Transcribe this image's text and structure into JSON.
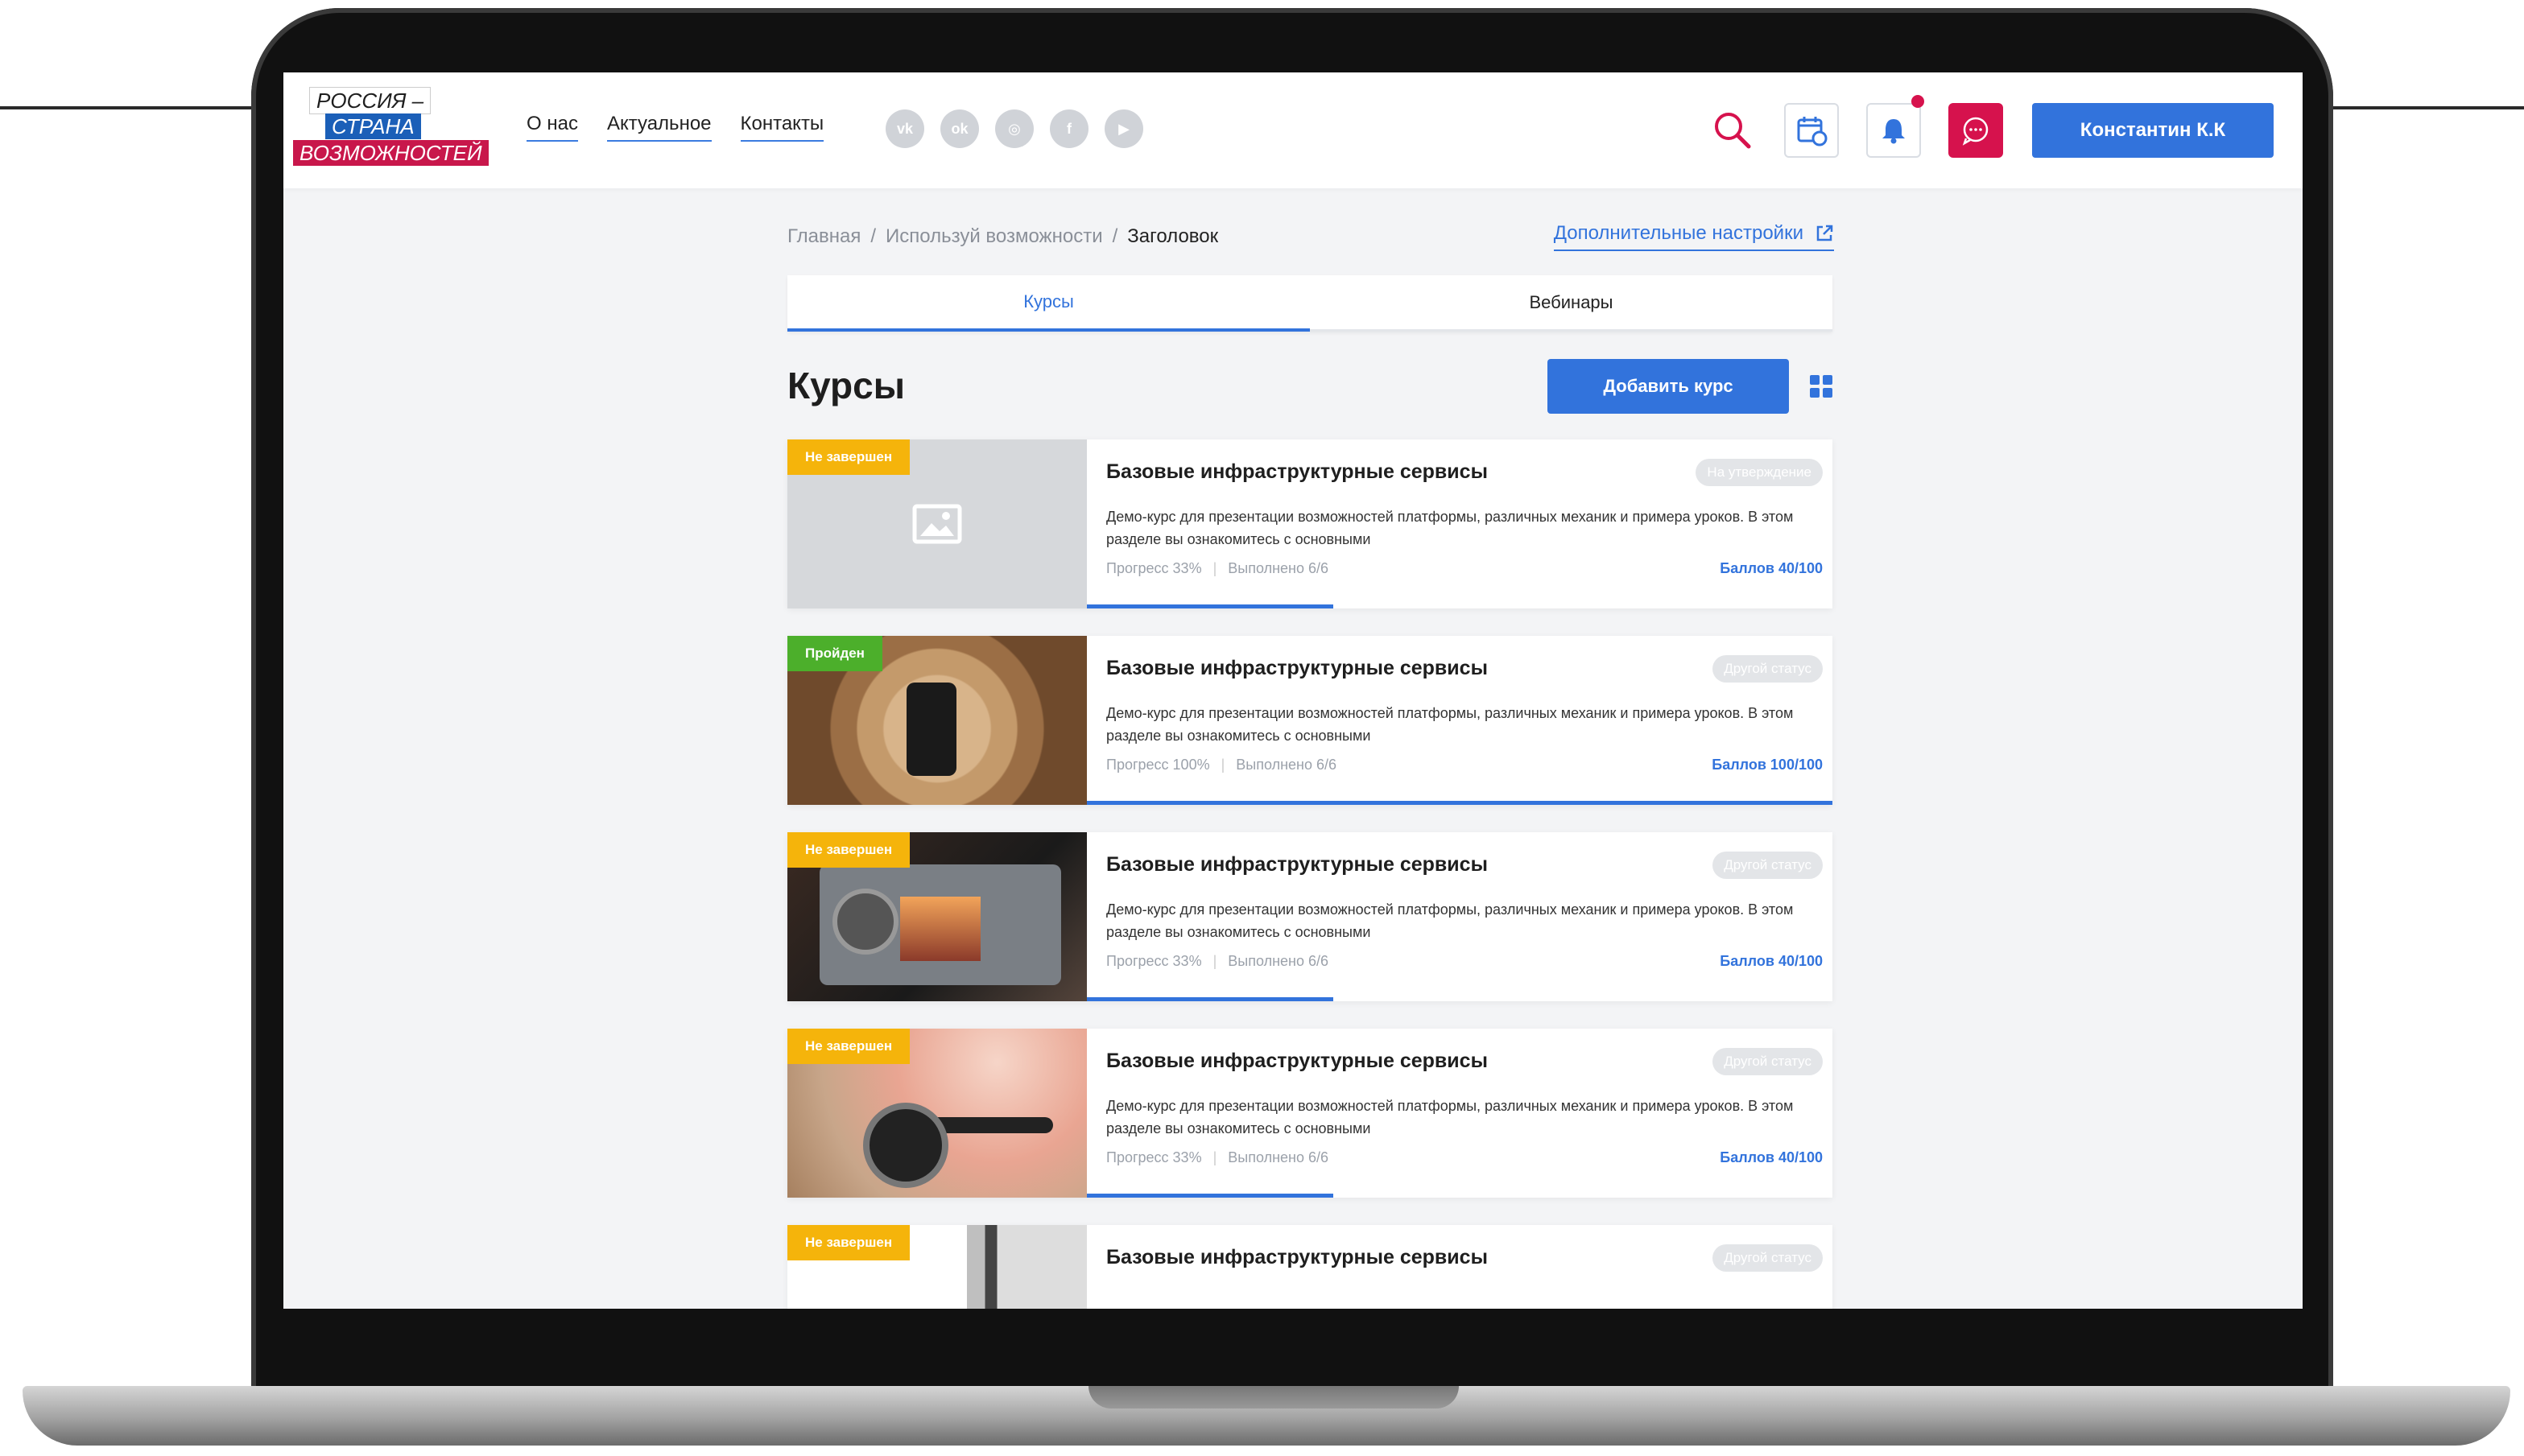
{
  "logo": {
    "line1": "РОССИЯ –",
    "line2": "СТРАНА",
    "line3": "ВОЗМОЖНОСТЕЙ"
  },
  "nav": [
    {
      "label": "О нас"
    },
    {
      "label": "Актуальное"
    },
    {
      "label": "Контакты"
    }
  ],
  "socials": [
    {
      "icon": "vk-icon",
      "glyph": "vk"
    },
    {
      "icon": "odnoklassniki-icon",
      "glyph": "ok"
    },
    {
      "icon": "instagram-icon",
      "glyph": "◎"
    },
    {
      "icon": "facebook-icon",
      "glyph": "f"
    },
    {
      "icon": "youtube-icon",
      "glyph": "▶"
    }
  ],
  "user": {
    "name": "Константин К.К"
  },
  "colors": {
    "accent": "#3273dc",
    "brand_red": "#d6124d",
    "badge_incomplete": "#f5b40b",
    "badge_passed": "#4caf2b"
  },
  "breadcrumbs": {
    "home": "Главная",
    "section": "Используй возможности",
    "current": "Заголовок"
  },
  "extra_settings": "Дополнительные настройки",
  "tabs": [
    {
      "label": "Курсы",
      "active": true
    },
    {
      "label": "Вебинары",
      "active": false
    }
  ],
  "page_title": "Курсы",
  "add_button": "Добавить курс",
  "courses": [
    {
      "badge": "Не завершен",
      "title": "Базовые инфраструктурные сервисы",
      "status": "На утверждение",
      "desc": "Демо-курс для презентации возможностей платформы, различных механик и примера уроков.  В этом разделе вы ознакомитесь с основными",
      "progress_label": "Прогресс 33%",
      "done": "Выполнено 6/6",
      "score": "Баллов 40/100",
      "progress": 33
    },
    {
      "badge": "Пройден",
      "title": "Базовые инфраструктурные сервисы",
      "status": "Другой статус",
      "desc": "Демо-курс для презентации возможностей платформы, различных механик и примера уроков.  В этом разделе вы ознакомитесь с основными",
      "progress_label": "Прогресс 100%",
      "done": "Выполнено 6/6",
      "score": "Баллов 100/100",
      "progress": 100
    },
    {
      "badge": "Не завершен",
      "title": "Базовые инфраструктурные сервисы",
      "status": "Другой статус",
      "desc": "Демо-курс для презентации возможностей платформы, различных механик и примера уроков.  В этом разделе вы ознакомитесь с основными",
      "progress_label": "Прогресс 33%",
      "done": "Выполнено 6/6",
      "score": "Баллов 40/100",
      "progress": 33
    },
    {
      "badge": "Не завершен",
      "title": "Базовые инфраструктурные сервисы",
      "status": "Другой статус",
      "desc": "Демо-курс для презентации возможностей платформы, различных механик и примера уроков.  В этом разделе вы ознакомитесь с основными",
      "progress_label": "Прогресс 33%",
      "done": "Выполнено 6/6",
      "score": "Баллов 40/100",
      "progress": 33
    },
    {
      "badge": "Не завершен",
      "title": "Базовые инфраструктурные сервисы",
      "status": "Другой статус",
      "desc": "",
      "progress_label": "",
      "done": "",
      "score": "",
      "progress": 0
    }
  ]
}
